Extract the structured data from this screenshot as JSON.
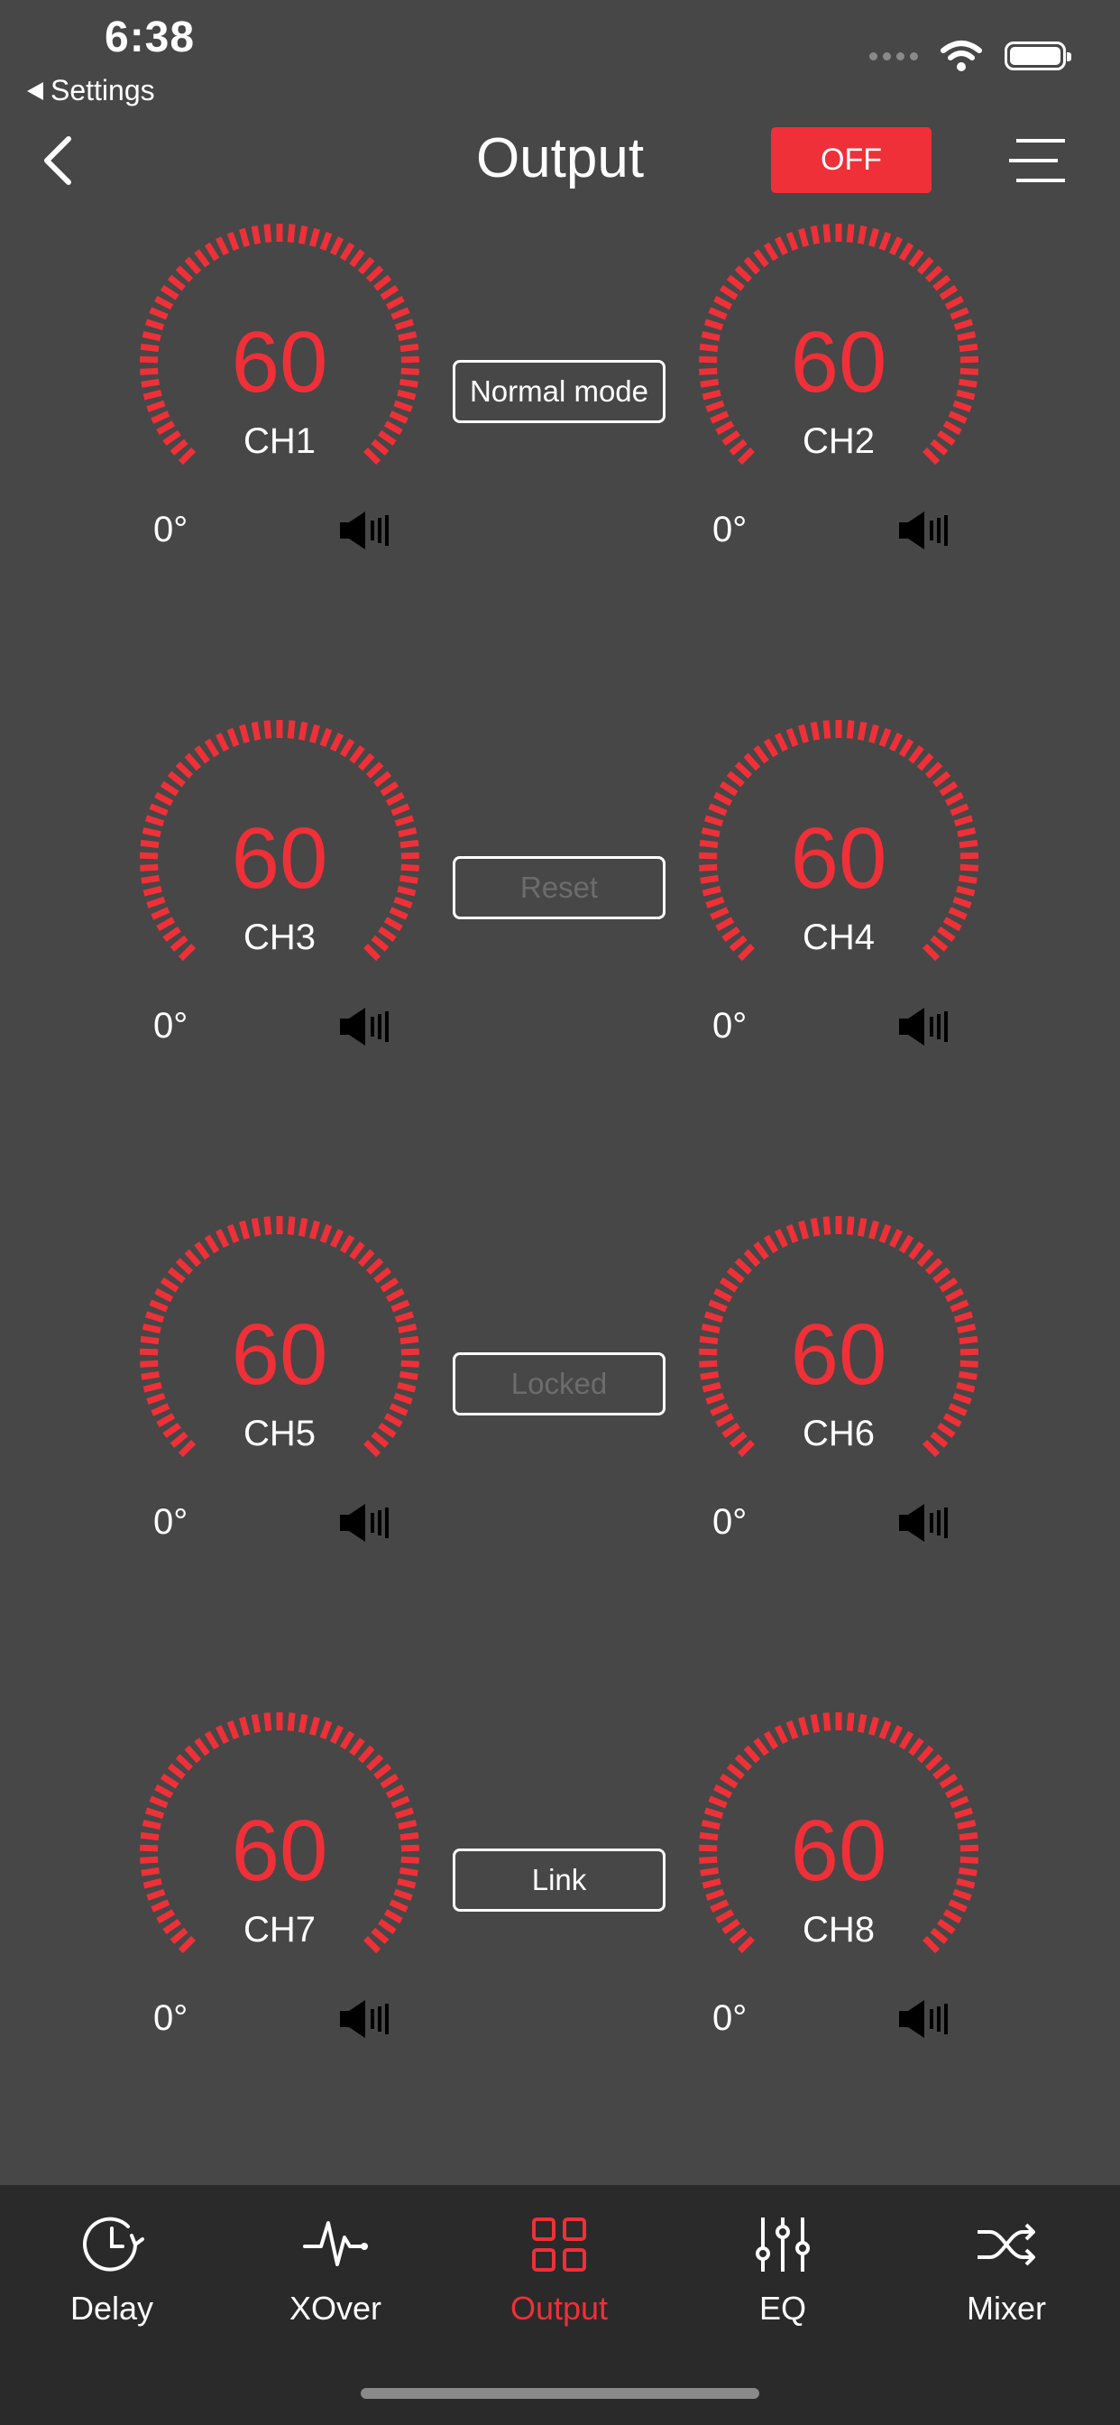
{
  "status": {
    "time": "6:38",
    "back_app": "Settings"
  },
  "header": {
    "title": "Output",
    "power_label": "OFF"
  },
  "channels": [
    {
      "value": "60",
      "label": "CH1",
      "phase": "0°"
    },
    {
      "value": "60",
      "label": "CH2",
      "phase": "0°"
    },
    {
      "value": "60",
      "label": "CH3",
      "phase": "0°"
    },
    {
      "value": "60",
      "label": "CH4",
      "phase": "0°"
    },
    {
      "value": "60",
      "label": "CH5",
      "phase": "0°"
    },
    {
      "value": "60",
      "label": "CH6",
      "phase": "0°"
    },
    {
      "value": "60",
      "label": "CH7",
      "phase": "0°"
    },
    {
      "value": "60",
      "label": "CH8",
      "phase": "0°"
    }
  ],
  "buttons": {
    "mode": "Normal mode",
    "reset": "Reset",
    "locked": "Locked",
    "link": "Link"
  },
  "tabs": [
    {
      "label": "Delay",
      "icon": "clock-icon"
    },
    {
      "label": "XOver",
      "icon": "waveform-icon"
    },
    {
      "label": "Output",
      "icon": "grid-icon"
    },
    {
      "label": "EQ",
      "icon": "sliders-icon"
    },
    {
      "label": "Mixer",
      "icon": "shuffle-icon"
    }
  ],
  "colors": {
    "accent": "#ef3038",
    "background": "#474747",
    "tabbar": "#2a2a2a"
  }
}
